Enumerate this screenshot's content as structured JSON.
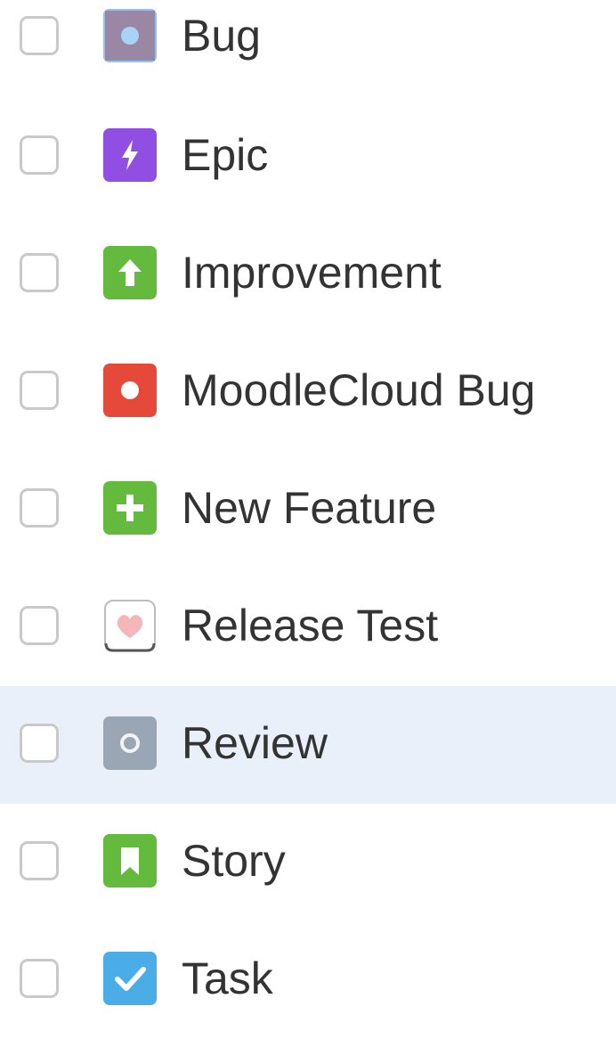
{
  "issue_types": [
    {
      "label": "Bug",
      "icon": "bug-icon",
      "color": "#9a87a5",
      "checked": false,
      "focused": true
    },
    {
      "label": "Epic",
      "icon": "lightning-bolt-icon",
      "color": "#904ee2",
      "checked": false
    },
    {
      "label": "Improvement",
      "icon": "arrow-up-icon",
      "color": "#63ba3c",
      "checked": false
    },
    {
      "label": "MoodleCloud Bug",
      "icon": "dot-icon",
      "color": "#e5493a",
      "checked": false
    },
    {
      "label": "New Feature",
      "icon": "plus-icon",
      "color": "#63ba3c",
      "checked": false
    },
    {
      "label": "Release Test",
      "icon": "heart-icon",
      "color": "#f4b6b8",
      "checked": false
    },
    {
      "label": "Review",
      "icon": "ring-icon",
      "color": "#9aa6b3",
      "checked": false,
      "highlighted": true
    },
    {
      "label": "Story",
      "icon": "bookmark-icon",
      "color": "#63ba3c",
      "checked": false
    },
    {
      "label": "Task",
      "icon": "checkmark-icon",
      "color": "#4bade8",
      "checked": false
    }
  ]
}
